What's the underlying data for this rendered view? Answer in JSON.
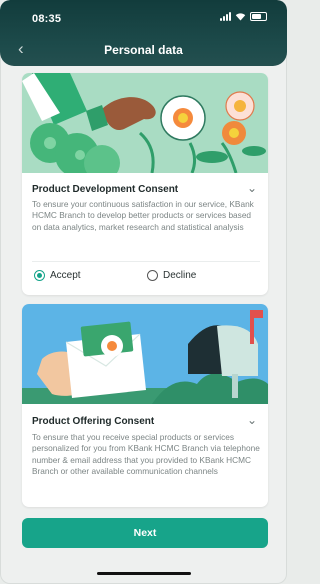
{
  "status_bar": {
    "time": "08:35"
  },
  "header": {
    "title": "Personal data",
    "back_icon": "chevron-left-icon"
  },
  "cards": [
    {
      "title": "Product Development Consent",
      "description": "To ensure your continuous satisfaction in our service, KBank HCMC Branch to develop better products or services based on data analytics, market research and statistical analysis",
      "options": [
        {
          "label": "Accept",
          "selected": true
        },
        {
          "label": "Decline",
          "selected": false
        }
      ]
    },
    {
      "title": "Product Offering Consent",
      "description": "To ensure that you receive special products or services personalized for you from KBank HCMC Branch via telephone number & email address that you provided to KBank HCMC Branch or other available communication channels"
    }
  ],
  "footer": {
    "next_label": "Next"
  },
  "colors": {
    "accent": "#17a48a",
    "header": "#1d4b4b"
  }
}
